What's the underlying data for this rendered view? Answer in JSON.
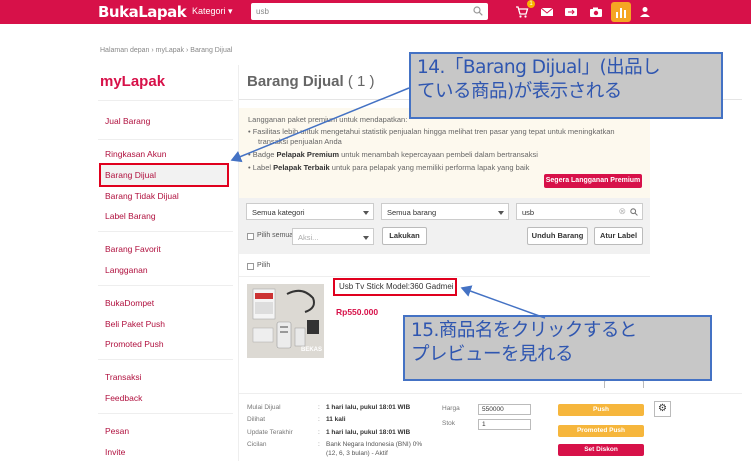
{
  "header": {
    "logo": "BukaLapak",
    "kategori_label": "Kategori",
    "search_value": "usb",
    "cart_badge": "1",
    "colors": {
      "brand": "#d71149",
      "accent": "#f5a623"
    }
  },
  "breadcrumb": "Halaman depan  ›  myLapak  ›  Barang Dijual",
  "sidebar": {
    "title": "myLapak",
    "items": [
      "Jual Barang",
      "Ringkasan Akun",
      "Barang Dijual",
      "Barang Tidak Dijual",
      "Label Barang",
      "Barang Favorit",
      "Langganan",
      "BukaDompet",
      "Beli Paket Push",
      "Promoted Push",
      "Transaksi",
      "Feedback",
      "Pesan",
      "Invite"
    ]
  },
  "main": {
    "title": "Barang Dijual",
    "count": "( 1 )",
    "premium": {
      "intro": "Langganan paket premium untuk mendapatkan:",
      "bullet1": "Fasilitas lebih untuk mengetahui statistik penjualan hingga melihat tren pasar yang tepat untuk meningkatkan",
      "bullet1b": "transaksi penjualan Anda",
      "bullet2_pre": "Badge ",
      "bullet2_bold": "Pelapak Premium",
      "bullet2_post": " untuk menambah kepercayaan pembeli dalam bertransaksi",
      "bullet3_pre": "Label ",
      "bullet3_bold": "Pelapak Terbaik",
      "bullet3_post": " untuk para pelapak yang memiliki performa lapak yang baik",
      "button": "Segera Langganan Premium"
    },
    "filters": {
      "kategori": "Semua kategori",
      "barang": "Semua barang",
      "search_value": "usb",
      "pilih_semua": "Pilih semua",
      "aksi_placeholder": "Aksi...",
      "lakukan": "Lakukan",
      "unduh": "Unduh Barang",
      "atur_label": "Atur Label"
    },
    "pilih": "Pilih",
    "product": {
      "name": "Usb Tv Stick Model:360 Gadmei",
      "price": "Rp550.000",
      "image_tag": "BEKAS"
    },
    "details": {
      "rows": [
        {
          "label": "Mulai Dijual",
          "value": "1 hari lalu, pukul 18:01 WIB"
        },
        {
          "label": "Dilihat",
          "value": "11 kali"
        },
        {
          "label": "Update Terakhir",
          "value": "1 hari lalu, pukul 18:01 WIB"
        },
        {
          "label": "Cicilan",
          "value": "Bank Negara Indonesia (BNI) 0%",
          "value2": "(12, 6, 3 bulan) - Aktif"
        }
      ],
      "harga_label": "Harga",
      "harga_value": "550000",
      "stok_label": "Stok",
      "stok_value": "1",
      "push": "Push",
      "promoted_push": "Promoted Push",
      "set_diskon": "Set Diskon"
    }
  },
  "annotations": {
    "a14_line1": "14.「Barang Dijual」(出品し",
    "a14_line2": "ている商品)が表示される",
    "a15_line1": "15.商品名をクリックすると",
    "a15_line2": "プレビューを見れる"
  }
}
